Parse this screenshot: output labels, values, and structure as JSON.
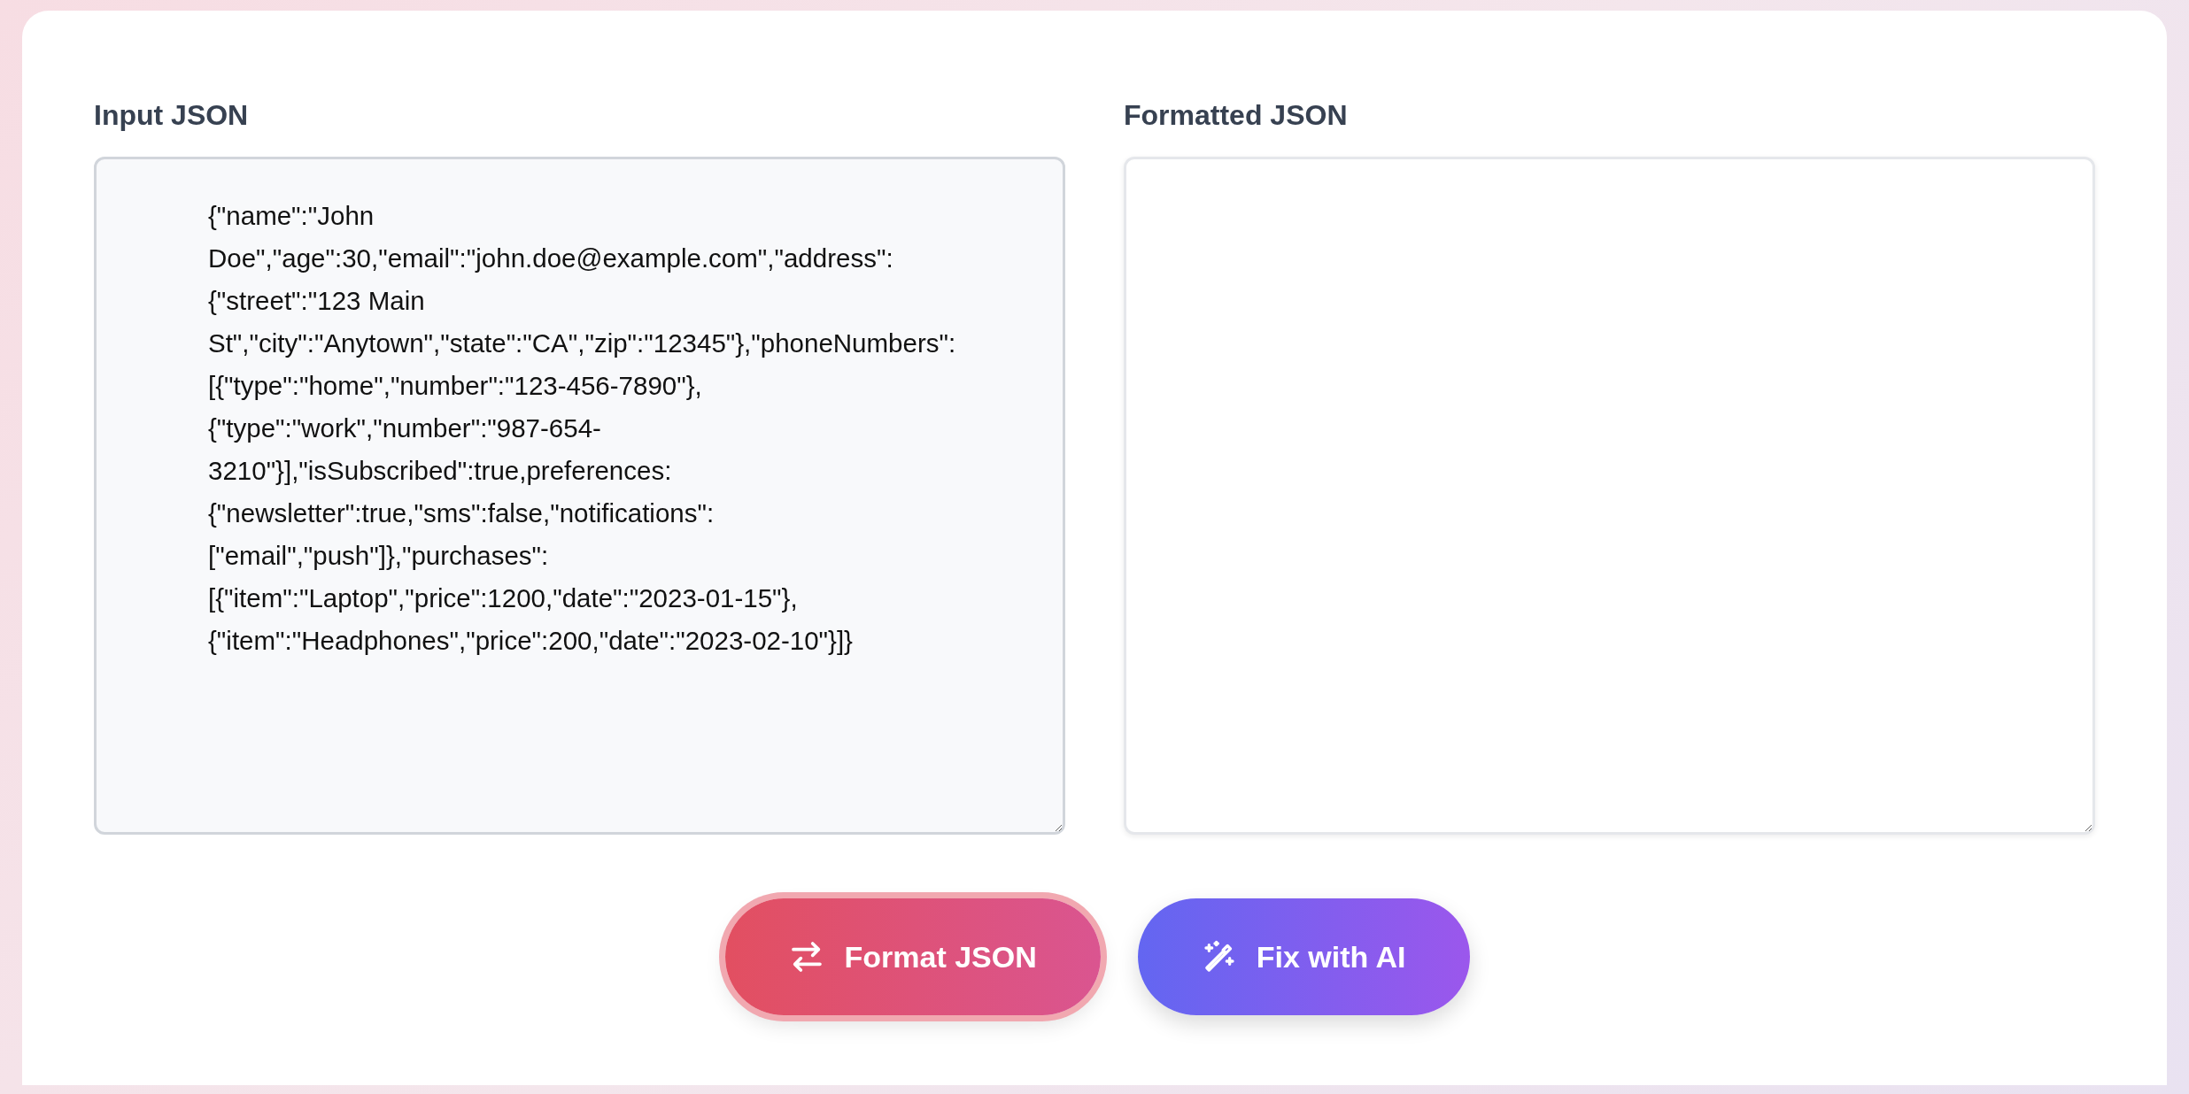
{
  "input_panel": {
    "label": "Input JSON",
    "value": "{\"name\":\"John Doe\",\"age\":30,\"email\":\"john.doe@example.com\",\"address\":{\"street\":\"123 Main St\",\"city\":\"Anytown\",\"state\":\"CA\",\"zip\":\"12345\"},\"phoneNumbers\":[{\"type\":\"home\",\"number\":\"123-456-7890\"},{\"type\":\"work\",\"number\":\"987-654-3210\"}],\"isSubscribed\":true,preferences:{\"newsletter\":true,\"sms\":false,\"notifications\":[\"email\",\"push\"]},\"purchases\":[{\"item\":\"Laptop\",\"price\":1200,\"date\":\"2023-01-15\"},{\"item\":\"Headphones\",\"price\":200,\"date\":\"2023-02-10\"}]}"
  },
  "output_panel": {
    "label": "Formatted JSON"
  },
  "buttons": [
    {
      "kind": "format",
      "label": "Format JSON",
      "focused": true
    },
    {
      "kind": "ai",
      "label": "Fix with AI",
      "focused": false
    }
  ]
}
